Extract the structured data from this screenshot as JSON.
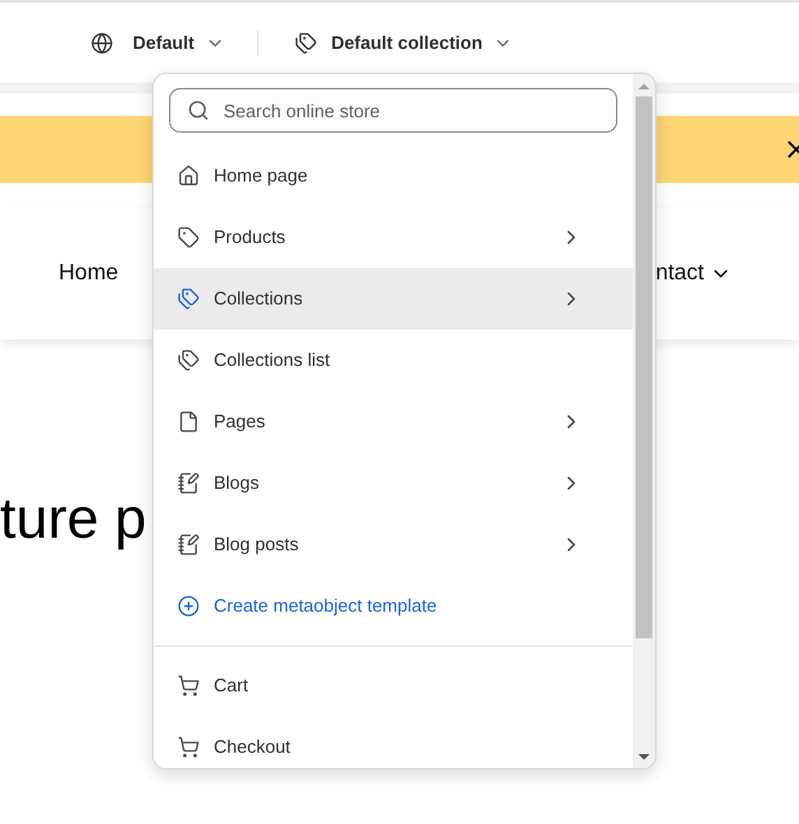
{
  "toolbar": {
    "language": "Default",
    "collection": "Default collection"
  },
  "preview": {
    "nav_left": "Home",
    "nav_right": "ntact",
    "heading": "ture p"
  },
  "menu": {
    "search": {
      "placeholder": "Search online store"
    },
    "sections": [
      {
        "items": [
          {
            "kind": "home",
            "label": "Home page",
            "has_children": false,
            "selected": false
          },
          {
            "kind": "product",
            "label": "Products",
            "has_children": true,
            "selected": false
          },
          {
            "kind": "collection",
            "label": "Collections",
            "has_children": true,
            "selected": true
          },
          {
            "kind": "collection",
            "label": "Collections list",
            "has_children": false,
            "selected": false
          },
          {
            "kind": "page",
            "label": "Pages",
            "has_children": true,
            "selected": false
          },
          {
            "kind": "blog",
            "label": "Blogs",
            "has_children": true,
            "selected": false
          },
          {
            "kind": "blog",
            "label": "Blog posts",
            "has_children": true,
            "selected": false
          },
          {
            "kind": "create",
            "label": "Create metaobject template",
            "has_children": false,
            "selected": false
          }
        ]
      },
      {
        "items": [
          {
            "kind": "cart",
            "label": "Cart",
            "has_children": false,
            "selected": false
          },
          {
            "kind": "cart",
            "label": "Checkout",
            "has_children": false,
            "selected": false
          }
        ]
      }
    ]
  }
}
